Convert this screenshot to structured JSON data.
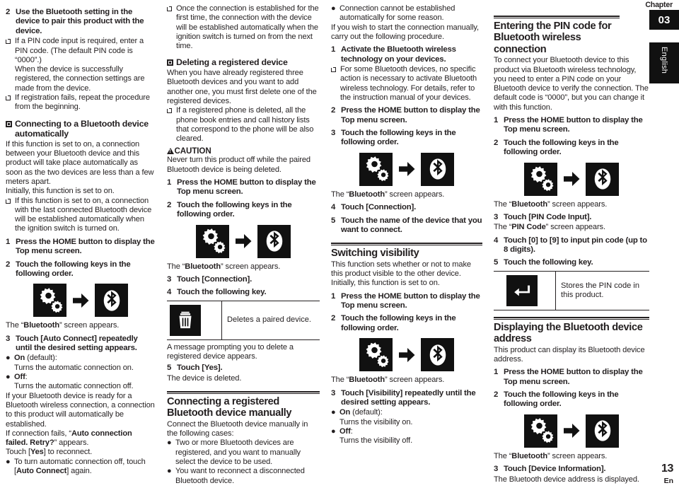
{
  "meta": {
    "chapter_label": "Chapter",
    "chapter_number": "03",
    "language_tab": "English",
    "page_number": "13",
    "page_language": "En"
  },
  "icons": {
    "gear": "gear-settings-icon",
    "arrow": "arrow-right-icon",
    "bluetooth": "bluetooth-icon",
    "trash": "trash-delete-icon",
    "enter": "enter-return-icon",
    "caution": "caution-triangle-icon"
  },
  "col1": {
    "step2": {
      "num": "2",
      "text": "Use the Bluetooth setting in the device to pair this product with the device."
    },
    "note1_a": "If a PIN code input is required, enter a PIN code. (The default PIN code is “0000”.)",
    "note1_b": "When the device is successfully registered, the connection settings are made from the device.",
    "note2": "If registration fails, repeat the procedure from the beginning.",
    "heading": "Connecting to a Bluetooth device automatically",
    "para1": "If this function is set to on, a connection between your Bluetooth device and this product will take place automatically as soon as the two devices are less than a few meters apart.",
    "para2": "Initially, this function is set to on.",
    "note3": "If this function is set to on, a connection with the last connected Bluetooth device will be established automatically when the ignition switch is turned on.",
    "step1": {
      "num": "1",
      "text": "Press the HOME button to display the Top menu screen."
    },
    "step2b": {
      "num": "2",
      "text": "Touch the following keys in the following order."
    },
    "screen_appears_pre": "The “",
    "screen_appears_name": "Bluetooth",
    "screen_appears_post": "” screen appears.",
    "step3": {
      "num": "3",
      "text": "Touch [Auto Connect] repeatedly until the desired setting appears."
    },
    "opt_on_label": "On",
    "opt_on_suffix": " (default):",
    "opt_on_desc": "Turns the automatic connection on.",
    "opt_off_label": "Off",
    "opt_off_suffix": ":",
    "opt_off_desc": "Turns the automatic connection off.",
    "para3": "If your Bluetooth device is ready for a Bluetooth wireless connection, a connection to this product will automatically be established.",
    "para4_pre": "If connection fails, “",
    "para4_bold": "Auto connection failed. Retry?",
    "para4_post": "” appears.",
    "para5_pre": "Touch [",
    "para5_bold": "Yes",
    "para5_post": "] to reconnect.",
    "bullet_last_pre": "To turn automatic connection off, touch [",
    "bullet_last_bold": "Auto Connect",
    "bullet_last_post": "] again."
  },
  "col2": {
    "note1": "Once the connection is established for the first time, the connection with the device will be established automatically when the ignition switch is turned on from the next time.",
    "heading": "Deleting a registered device",
    "para1": "When you have already registered three Bluetooth devices and you want to add another one, you must first delete one of the registered devices.",
    "note2": "If a registered phone is deleted, all the phone book entries and call history lists that correspond to the phone will be also cleared.",
    "caution_title": "CAUTION",
    "caution_text": "Never turn this product off while the paired Bluetooth device is being deleted.",
    "step1": {
      "num": "1",
      "text": "Press the HOME button to display the Top menu screen."
    },
    "step2": {
      "num": "2",
      "text": "Touch the following keys in the following order."
    },
    "screen_appears_pre": "The “",
    "screen_appears_name": "Bluetooth",
    "screen_appears_post": "” screen appears.",
    "step3": {
      "num": "3",
      "text": "Touch [Connection]."
    },
    "step4": {
      "num": "4",
      "text": "Touch the following key."
    },
    "key_desc": "Deletes a paired device.",
    "para2": "A message prompting you to delete a registered device appears.",
    "step5": {
      "num": "5",
      "text": "Touch [Yes]."
    },
    "para3": "The device is deleted.",
    "section_heading": "Connecting a registered Bluetooth device manually",
    "para4": "Connect the Bluetooth device manually in the following cases:",
    "bullet1": "Two or more Bluetooth devices are registered, and you want to manually select the device to be used.",
    "bullet2": "You want to reconnect a disconnected Bluetooth device."
  },
  "col3": {
    "bullet1": "Connection cannot be established automatically for some reason.",
    "para1": "If you wish to start the connection manually, carry out the following procedure.",
    "step1": {
      "num": "1",
      "text": "Activate the Bluetooth wireless technology on your devices."
    },
    "note1": "For some Bluetooth devices, no specific action is necessary to activate Bluetooth wireless technology. For details, refer to the instruction manual of your devices.",
    "step2": {
      "num": "2",
      "text": "Press the HOME button to display the Top menu screen."
    },
    "step3": {
      "num": "3",
      "text": "Touch the following keys in the following order."
    },
    "screen_appears_pre": "The “",
    "screen_appears_name": "Bluetooth",
    "screen_appears_post": "” screen appears.",
    "step4": {
      "num": "4",
      "text": "Touch [Connection]."
    },
    "step5": {
      "num": "5",
      "text": "Touch the name of the device that you want to connect."
    },
    "section_heading": "Switching visibility",
    "para2": "This function sets whether or not to make this product visible to the other device.",
    "para3": "Initially, this function is set to on.",
    "step1b": {
      "num": "1",
      "text": "Press the HOME button to display the Top menu screen."
    },
    "step2b": {
      "num": "2",
      "text": "Touch the following keys in the following order."
    },
    "screen_appears2_pre": "The “",
    "screen_appears2_name": "Bluetooth",
    "screen_appears2_post": "” screen appears.",
    "step3b": {
      "num": "3",
      "text": "Touch [Visibility] repeatedly until the desired setting appears."
    },
    "opt_on_label": "On",
    "opt_on_suffix": " (default):",
    "opt_on_desc": "Turns the visibility on.",
    "opt_off_label": "Off",
    "opt_off_suffix": ":",
    "opt_off_desc": "Turns the visibility off."
  },
  "col4": {
    "section_heading": "Entering the PIN code for Bluetooth wireless connection",
    "para1": "To connect your Bluetooth device to this product via Bluetooth wireless technology, you need to enter a PIN code on your Bluetooth device to verify the connection. The default code is “0000”, but you can change it with this function.",
    "step1": {
      "num": "1",
      "text": "Press the HOME button to display the Top menu screen."
    },
    "step2": {
      "num": "2",
      "text": "Touch the following keys in the following order."
    },
    "screen_appears_pre": "The “",
    "screen_appears_name": "Bluetooth",
    "screen_appears_post": "” screen appears.",
    "step3": {
      "num": "3",
      "text": "Touch [PIN Code Input]."
    },
    "pin_screen_pre": "The “",
    "pin_screen_name": "PIN Code",
    "pin_screen_post": "” screen appears.",
    "step4": {
      "num": "4",
      "text": "Touch [0] to [9] to input pin code (up to 8 digits)."
    },
    "step5": {
      "num": "5",
      "text": "Touch the following key."
    },
    "key_desc": "Stores the PIN code in this product.",
    "section_heading2": "Displaying the Bluetooth device address",
    "para2": "This product can display its Bluetooth device address.",
    "step1b": {
      "num": "1",
      "text": "Press the HOME button to display the Top menu screen."
    },
    "step2b": {
      "num": "2",
      "text": "Touch the following keys in the following order."
    },
    "screen_appears2_pre": "The “",
    "screen_appears2_name": "Bluetooth",
    "screen_appears2_post": "” screen appears.",
    "step3b": {
      "num": "3",
      "text": "Touch [Device Information]."
    },
    "para3": "The Bluetooth device address is displayed."
  }
}
